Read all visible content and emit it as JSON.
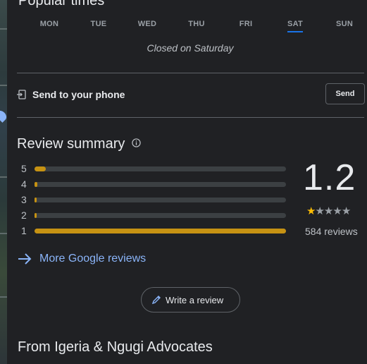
{
  "popular_times": {
    "heading": "Popular times",
    "days": [
      "MON",
      "TUE",
      "WED",
      "THU",
      "FRI",
      "SAT",
      "SUN"
    ],
    "selected_day": "SAT",
    "closed_text": "Closed on Saturday"
  },
  "send": {
    "label": "Send to your phone",
    "button": "Send"
  },
  "review_summary": {
    "title": "Review summary",
    "rows": [
      {
        "stars": "5",
        "fraction": 0.045
      },
      {
        "stars": "4",
        "fraction": 0.01
      },
      {
        "stars": "3",
        "fraction": 0.004
      },
      {
        "stars": "2",
        "fraction": 0.004
      },
      {
        "stars": "1",
        "fraction": 1.0
      }
    ],
    "rating": "1.2",
    "rating_stars_filled": 1,
    "rating_stars_total": 5,
    "review_count": "584 reviews",
    "more_link": "More Google reviews",
    "write_button": "Write a review"
  },
  "from_section": {
    "title": "From Igeria & Ngugi Advocates"
  },
  "colors": {
    "background": "#202124",
    "bar_fill": "#c69213",
    "link": "#8ab4f8",
    "star": "#fbbc04",
    "active_tab": "#1a73e8"
  }
}
